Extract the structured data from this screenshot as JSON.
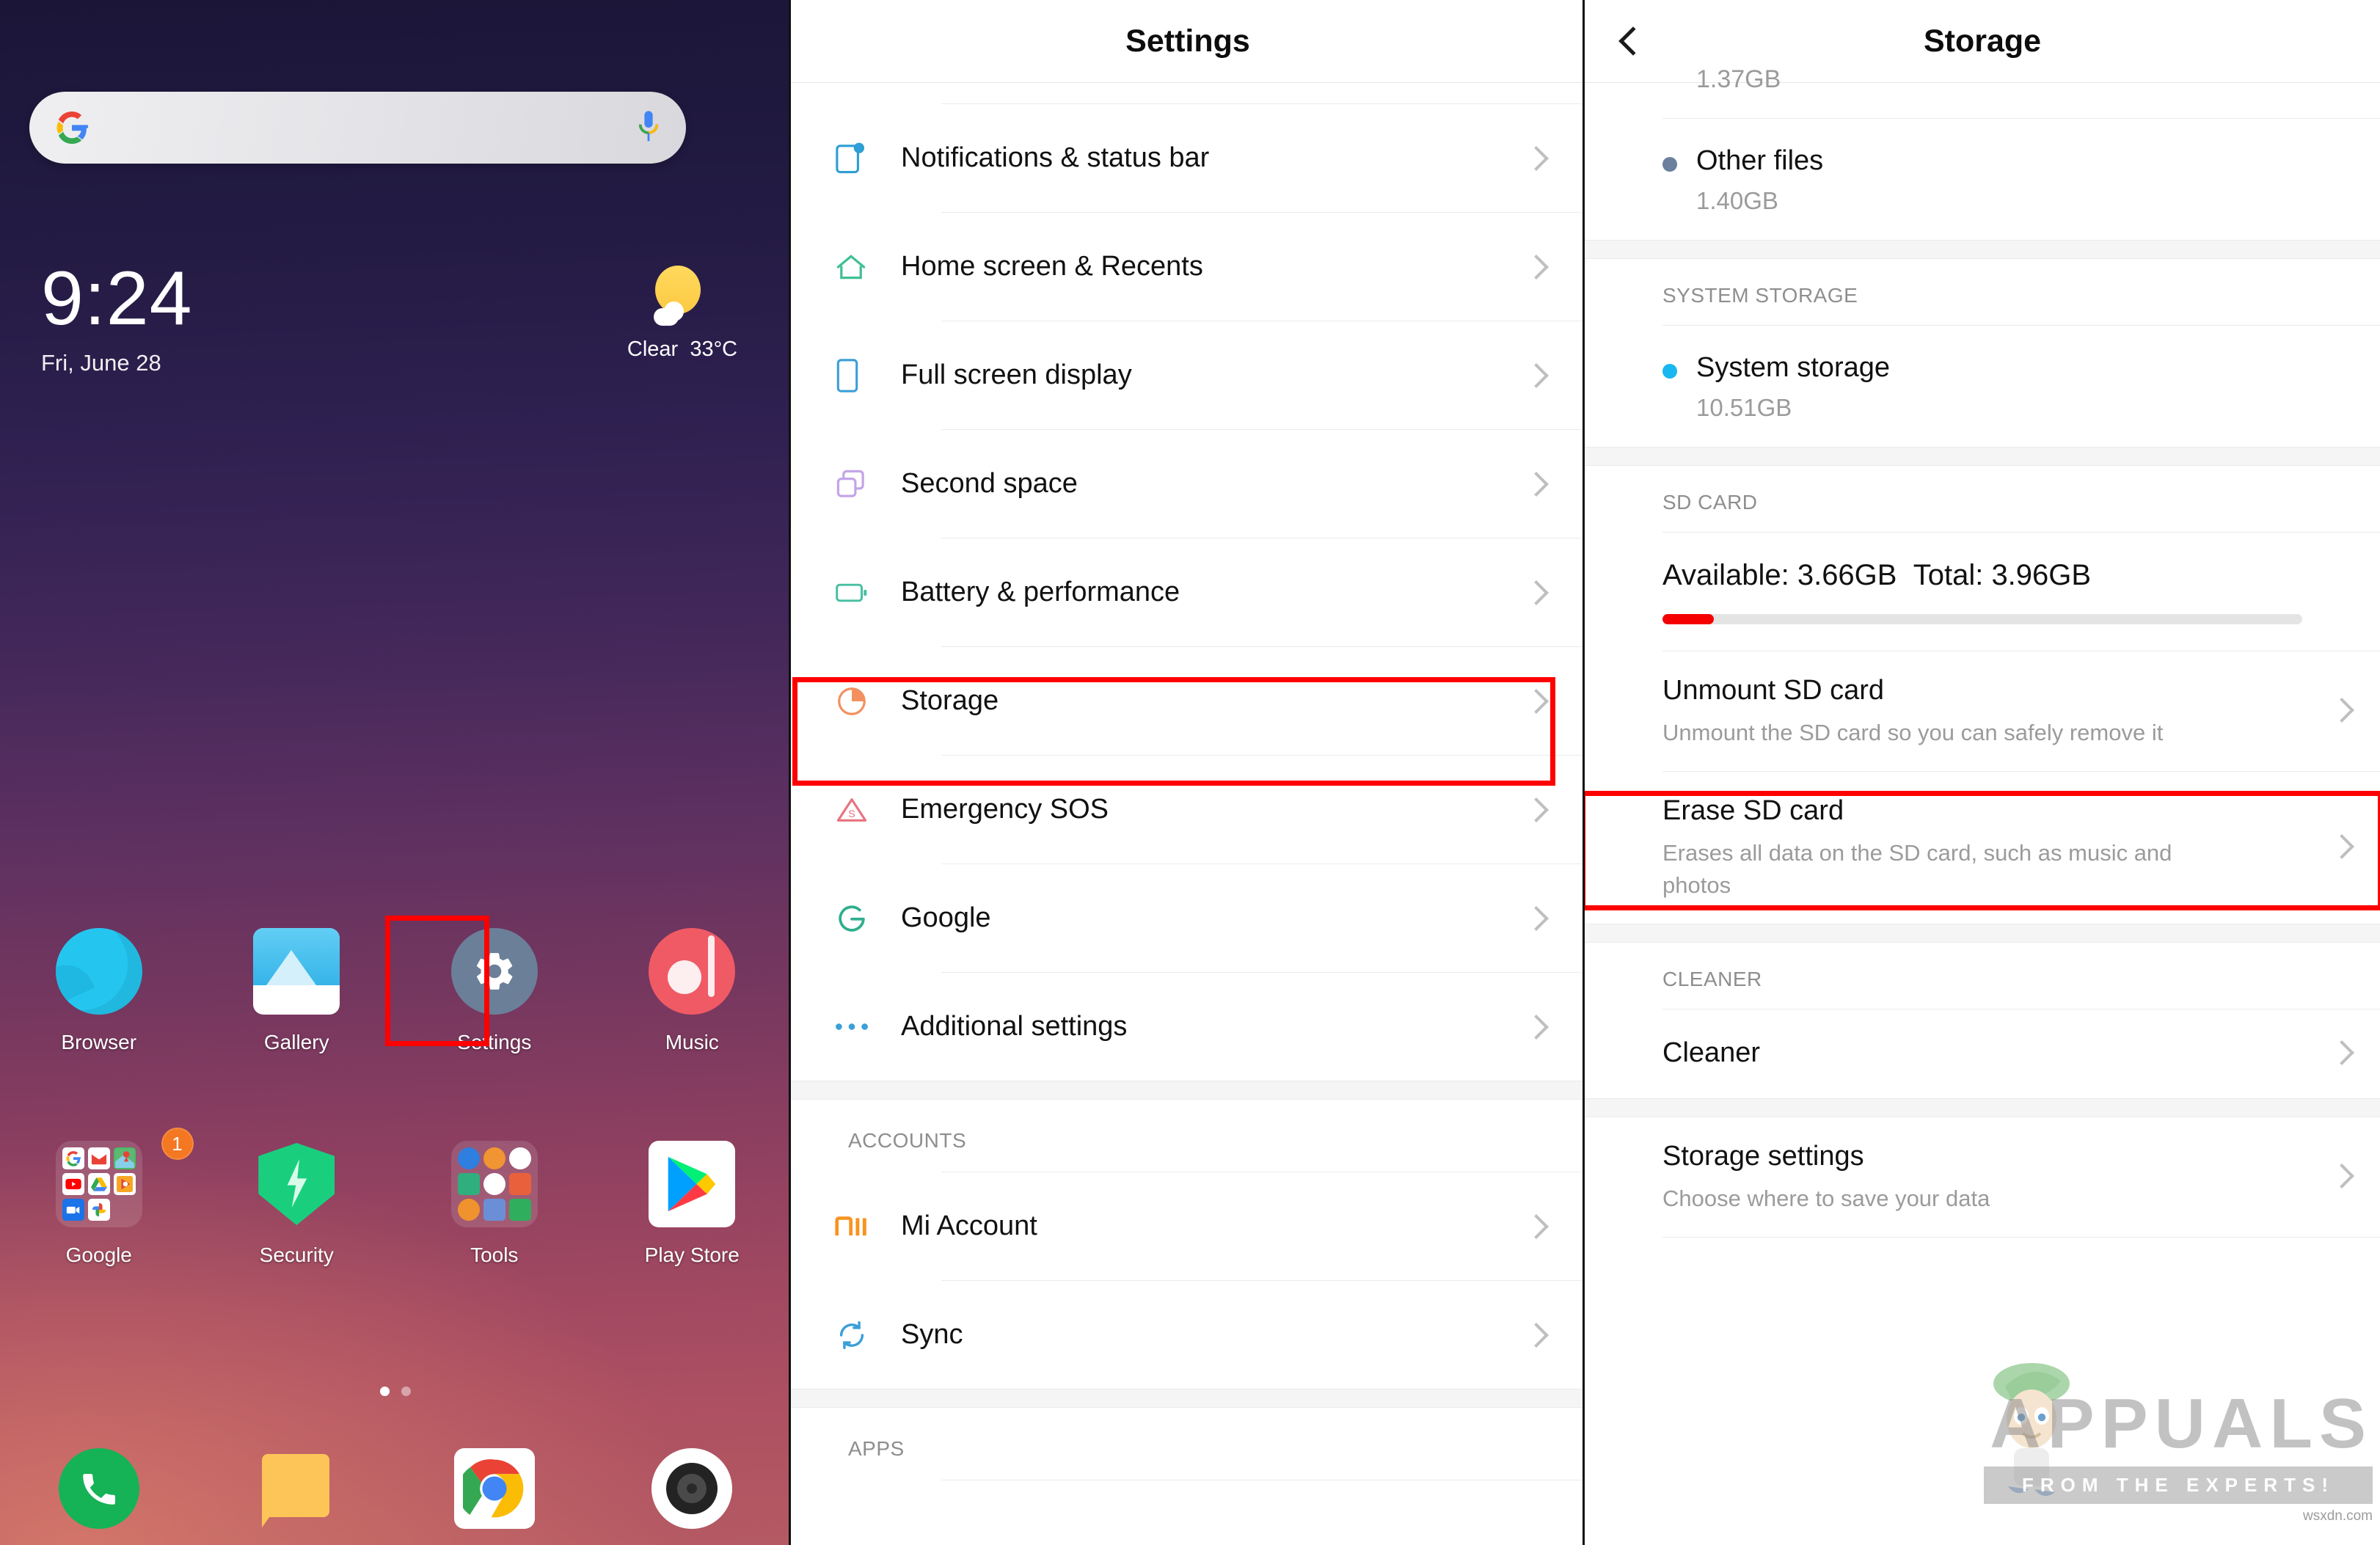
{
  "home": {
    "search": {
      "name": "google-search-widget",
      "placeholder": ""
    },
    "clock": {
      "time": "9:24",
      "date": "Fri, June 28"
    },
    "weather": {
      "condition": "Clear",
      "temperature": "33°C",
      "icon": "sun-behind-cloud-icon"
    },
    "apps": [
      {
        "label": "Browser",
        "icon": "browser-icon"
      },
      {
        "label": "Gallery",
        "icon": "gallery-icon"
      },
      {
        "label": "Settings",
        "icon": "settings-gear-icon",
        "highlighted": true
      },
      {
        "label": "Music",
        "icon": "music-note-icon"
      },
      {
        "label": "Google",
        "icon": "google-folder-icon",
        "badge": "1"
      },
      {
        "label": "Security",
        "icon": "security-shield-icon"
      },
      {
        "label": "Tools",
        "icon": "tools-folder-icon"
      },
      {
        "label": "Play Store",
        "icon": "play-store-icon"
      }
    ],
    "pager": {
      "pages": 2,
      "active": 1
    },
    "dock": [
      {
        "name": "phone-icon"
      },
      {
        "name": "messages-icon"
      },
      {
        "name": "chrome-icon"
      },
      {
        "name": "camera-icon"
      }
    ]
  },
  "settings": {
    "title": "Settings",
    "items": [
      {
        "label": "Notifications & status bar",
        "icon": "notification-badge-icon",
        "color": "#2f9fd6"
      },
      {
        "label": "Home screen & Recents",
        "icon": "home-icon",
        "color": "#3fbf96"
      },
      {
        "label": "Full screen display",
        "icon": "phone-frame-icon",
        "color": "#3b9fd8"
      },
      {
        "label": "Second space",
        "icon": "two-squares-icon",
        "color": "#c3a5e8"
      },
      {
        "label": "Battery & performance",
        "icon": "battery-icon",
        "color": "#46bfa2"
      },
      {
        "label": "Storage",
        "icon": "pie-chart-icon",
        "color": "#f29060",
        "highlighted": true
      },
      {
        "label": "Emergency SOS",
        "icon": "sos-triangle-icon",
        "color": "#e8737f"
      },
      {
        "label": "Google",
        "icon": "google-g-icon",
        "color": "#2fae8e"
      },
      {
        "label": "Additional settings",
        "icon": "ellipsis-icon",
        "color": "#3b9fd8"
      }
    ],
    "section_accounts": "ACCOUNTS",
    "accounts_items": [
      {
        "label": "Mi Account",
        "icon": "mi-logo-icon",
        "color": "#f7931e"
      },
      {
        "label": "Sync",
        "icon": "sync-icon",
        "color": "#3b9fd8"
      }
    ],
    "section_apps": "APPS"
  },
  "storage": {
    "title": "Storage",
    "back_icon": "back-chevron-icon",
    "cut_off_value": "1.37GB",
    "categories": [
      {
        "name": "Other files",
        "size": "1.40GB",
        "dot_color": "#6b7f9e"
      }
    ],
    "section_system": "SYSTEM STORAGE",
    "system": [
      {
        "name": "System storage",
        "size": "10.51GB",
        "dot_color": "#18b7ef"
      }
    ],
    "section_sd": "SD CARD",
    "sd": {
      "available_label": "Available: 3.66GB",
      "total_label": "Total: 3.96GB",
      "bar_color": "#f50000",
      "used_percent": 8
    },
    "actions": [
      {
        "title": "Unmount SD card",
        "subtitle": "Unmount the SD card so you can safely remove it",
        "highlighted": true
      },
      {
        "title": "Erase SD card",
        "subtitle": "Erases all data on the SD card, such as music and photos",
        "highlighted": false
      }
    ],
    "section_cleaner": "CLEANER",
    "cleaner": {
      "title": "Cleaner"
    },
    "storage_settings": {
      "title": "Storage settings",
      "subtitle": "Choose where to save your data"
    }
  },
  "watermark": {
    "main": "APPUALS",
    "sub": "FROM THE EXPERTS!",
    "url": "wsxdn.com"
  },
  "colors": {
    "highlight": "#fe0000",
    "accent_red": "#f50000",
    "text_primary": "#111111",
    "text_secondary": "#9b9b9b"
  }
}
